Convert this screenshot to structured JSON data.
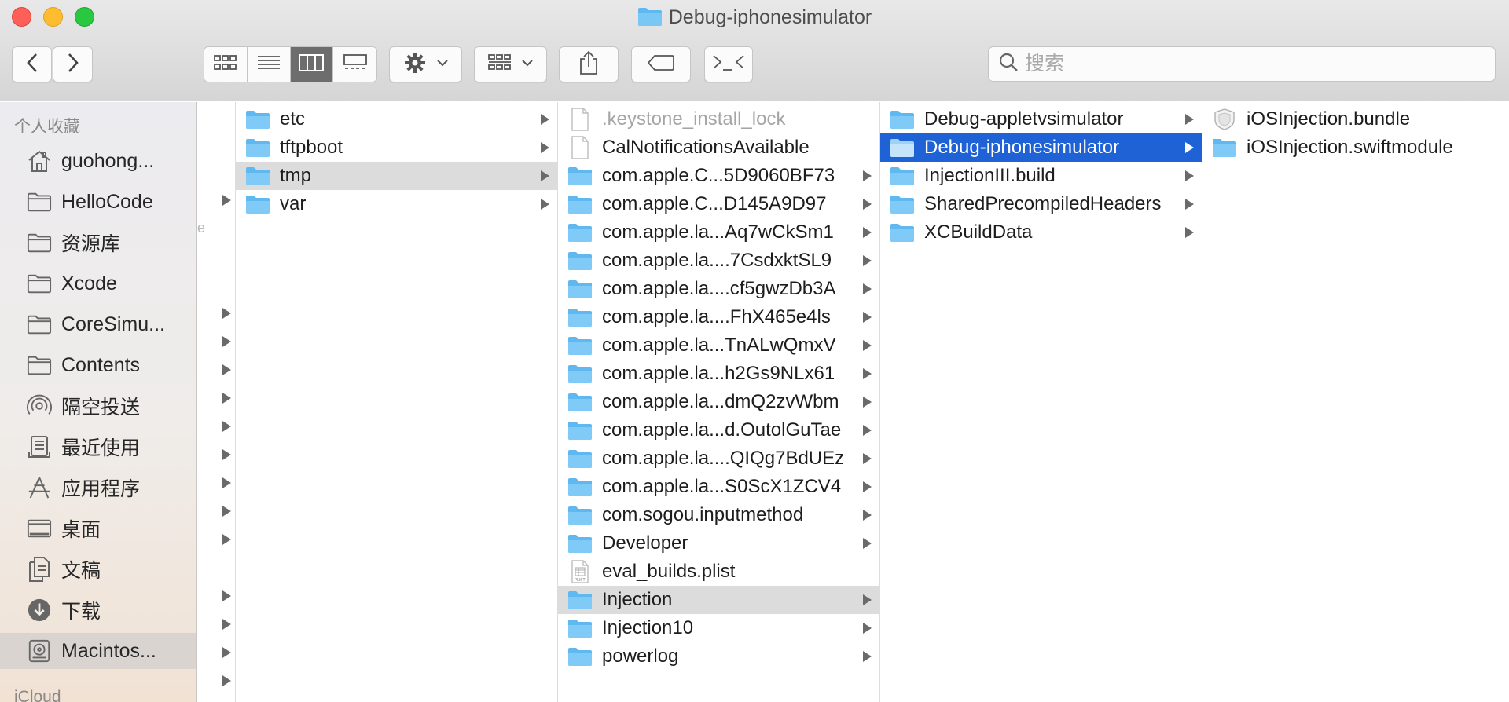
{
  "window": {
    "title": "Debug-iphonesimulator"
  },
  "toolbar": {
    "view_modes": [
      "icon-view",
      "list-view",
      "column-view",
      "gallery-view"
    ],
    "active_view": "column-view",
    "search_placeholder": "搜索"
  },
  "sidebar": {
    "favorites_header": "个人收藏",
    "icloud_header": "iCloud",
    "items": [
      {
        "label": "guohong...",
        "icon": "home-icon"
      },
      {
        "label": "HelloCode",
        "icon": "folder-icon"
      },
      {
        "label": "资源库",
        "icon": "folder-icon"
      },
      {
        "label": "Xcode",
        "icon": "folder-icon"
      },
      {
        "label": "CoreSimu...",
        "icon": "folder-icon"
      },
      {
        "label": "Contents",
        "icon": "folder-icon"
      },
      {
        "label": "隔空投送",
        "icon": "airdrop-icon"
      },
      {
        "label": "最近使用",
        "icon": "recents-icon"
      },
      {
        "label": "应用程序",
        "icon": "applications-icon"
      },
      {
        "label": "桌面",
        "icon": "desktop-icon"
      },
      {
        "label": "文稿",
        "icon": "documents-icon"
      },
      {
        "label": "下载",
        "icon": "downloads-icon"
      },
      {
        "label": "Macintos...",
        "icon": "hard-drive-icon",
        "selected": true
      }
    ]
  },
  "columns": {
    "col1": [
      {
        "name": "etc",
        "folder": true
      },
      {
        "name": "tftpboot",
        "folder": true
      },
      {
        "name": "tmp",
        "folder": true,
        "selected": "gray"
      },
      {
        "name": "var",
        "folder": true
      }
    ],
    "col2": [
      {
        "name": ".keystone_install_lock",
        "folder": false,
        "dim": true,
        "kind": "doc"
      },
      {
        "name": "CalNotificationsAvailable",
        "folder": false,
        "kind": "doc"
      },
      {
        "name": "com.apple.C...5D9060BF73",
        "folder": true
      },
      {
        "name": "com.apple.C...D145A9D97",
        "folder": true
      },
      {
        "name": "com.apple.la...Aq7wCkSm1",
        "folder": true
      },
      {
        "name": "com.apple.la....7CsdxktSL9",
        "folder": true
      },
      {
        "name": "com.apple.la....cf5gwzDb3A",
        "folder": true
      },
      {
        "name": "com.apple.la....FhX465e4ls",
        "folder": true
      },
      {
        "name": "com.apple.la...TnALwQmxV",
        "folder": true
      },
      {
        "name": "com.apple.la...h2Gs9NLx61",
        "folder": true
      },
      {
        "name": "com.apple.la...dmQ2zvWbm",
        "folder": true
      },
      {
        "name": "com.apple.la...d.OutolGuTae",
        "folder": true
      },
      {
        "name": "com.apple.la....QIQg7BdUEz",
        "folder": true
      },
      {
        "name": "com.apple.la...S0ScX1ZCV4",
        "folder": true
      },
      {
        "name": "com.sogou.inputmethod",
        "folder": true
      },
      {
        "name": "Developer",
        "folder": true
      },
      {
        "name": "eval_builds.plist",
        "folder": false,
        "kind": "plist"
      },
      {
        "name": "Injection",
        "folder": true,
        "selected": "gray"
      },
      {
        "name": "Injection10",
        "folder": true
      },
      {
        "name": "powerlog",
        "folder": true
      }
    ],
    "col3": [
      {
        "name": "Debug-appletvsimulator",
        "folder": true
      },
      {
        "name": "Debug-iphonesimulator",
        "folder": true,
        "selected": "blue"
      },
      {
        "name": "InjectionIII.build",
        "folder": true
      },
      {
        "name": "SharedPrecompiledHeaders",
        "folder": true
      },
      {
        "name": "XCBuildData",
        "folder": true
      }
    ],
    "col4": [
      {
        "name": "iOSInjection.bundle",
        "folder": false,
        "kind": "bundle"
      },
      {
        "name": "iOSInjection.swiftmodule",
        "folder": true
      }
    ]
  },
  "colors": {
    "folder": "#5fb8ef",
    "selection_blue": "#1e62d6",
    "selection_gray": "#dcdcdc"
  }
}
